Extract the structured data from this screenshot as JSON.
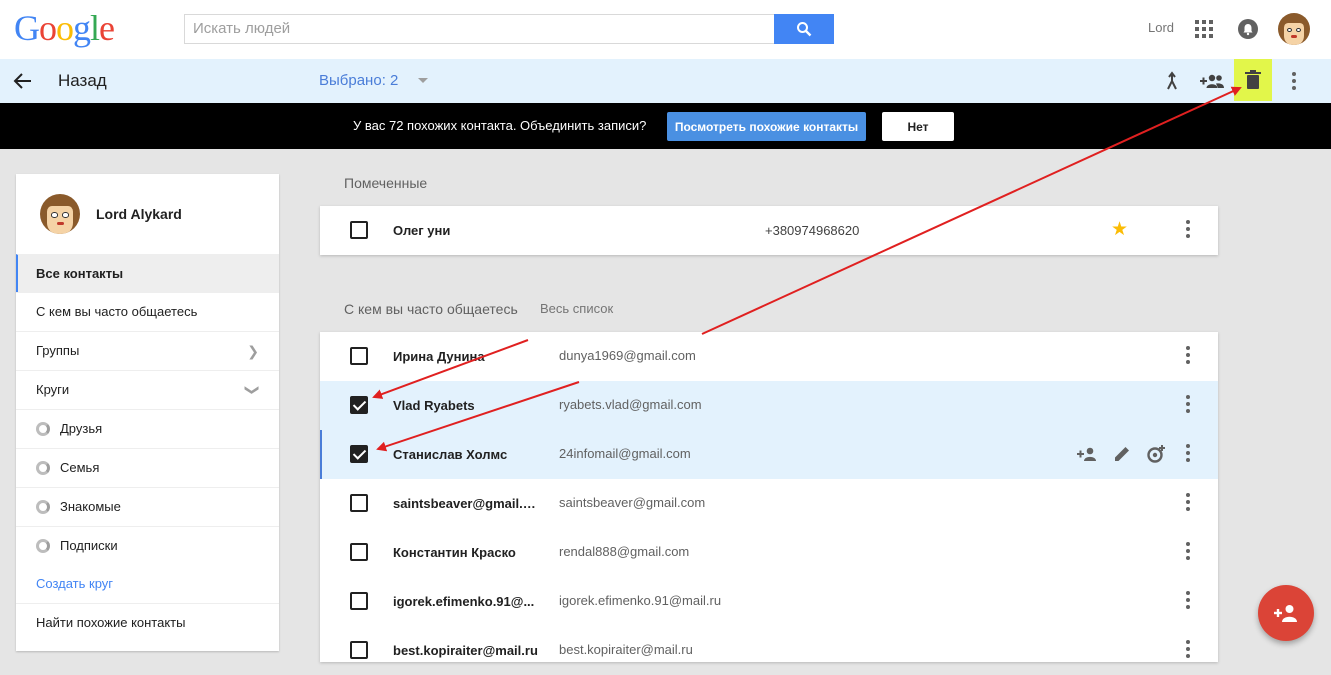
{
  "header": {
    "logo_text": "Google",
    "search_placeholder": "Искать людей",
    "user_name": "Lord"
  },
  "actionbar": {
    "back_label": "Назад",
    "selected_label": "Выбрано: 2"
  },
  "notice": {
    "text": "У вас 72 похожих контакта. Объединить записи?",
    "view_button": "Посмотреть похожие контакты",
    "no_button": "Нет"
  },
  "sidebar": {
    "profile_name": "Lord Alykard",
    "items": [
      {
        "label": "Все контакты"
      },
      {
        "label": "С кем вы часто общаетесь"
      },
      {
        "label": "Группы"
      },
      {
        "label": "Круги"
      },
      {
        "label": "Друзья"
      },
      {
        "label": "Семья"
      },
      {
        "label": "Знакомые"
      },
      {
        "label": "Подписки"
      },
      {
        "label": "Создать круг"
      },
      {
        "label": "Найти похожие контакты"
      }
    ]
  },
  "starred": {
    "title": "Помеченные",
    "contact": {
      "name": "Олег уни",
      "phone": "+380974968620"
    }
  },
  "frequent": {
    "title": "С кем вы часто общаетесь",
    "all_link": "Весь список",
    "contacts": [
      {
        "name": "Ирина Дунина",
        "email": "dunya1969@gmail.com",
        "checked": false
      },
      {
        "name": "Vlad Ryabets",
        "email": "ryabets.vlad@gmail.com",
        "checked": true
      },
      {
        "name": "Станислав Холмс",
        "email": "24infomail@gmail.com",
        "checked": true
      },
      {
        "name": "saintsbeaver@gmail.c...",
        "email": "saintsbeaver@gmail.com",
        "checked": false
      },
      {
        "name": "Константин Краско",
        "email": "rendal888@gmail.com",
        "checked": false
      },
      {
        "name": "igorek.efimenko.91@...",
        "email": "igorek.efimenko.91@mail.ru",
        "checked": false
      },
      {
        "name": "best.kopiraiter@mail.ru",
        "email": "best.kopiraiter@mail.ru",
        "checked": false
      }
    ]
  },
  "colors": {
    "accent": "#4285f4",
    "highlight": "#e2f64a",
    "selected_row": "#e3f2fd",
    "fab": "#db4437",
    "annotation_arrow": "#e02020"
  },
  "icons": [
    "search-icon",
    "apps-icon",
    "bell-icon",
    "back-icon",
    "merge-icon",
    "add-to-group-icon",
    "trash-icon",
    "more-icon",
    "star-icon",
    "add-contact-icon",
    "edit-icon",
    "circles-icon",
    "add-person-fab-icon"
  ]
}
